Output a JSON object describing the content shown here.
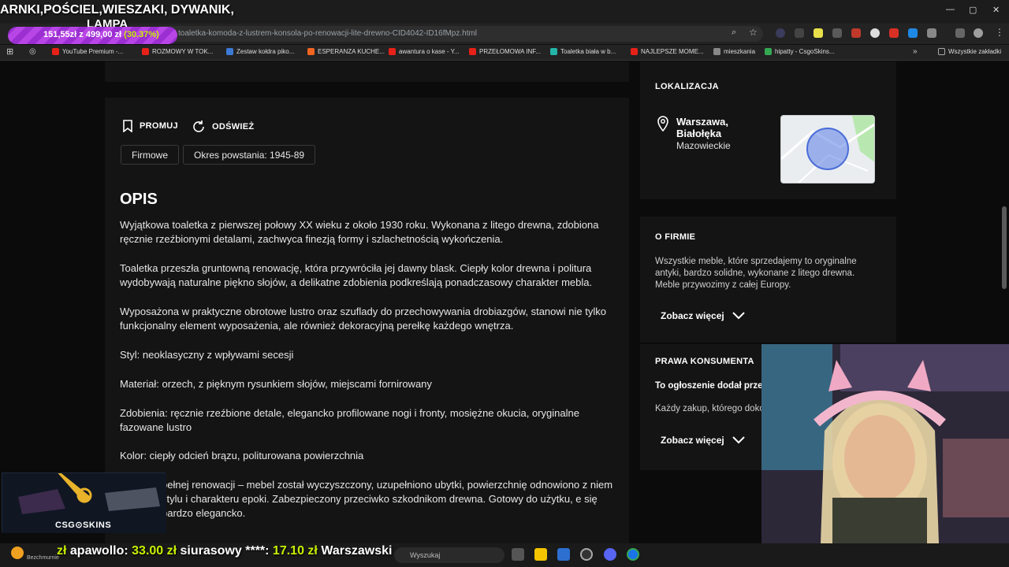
{
  "overlay": {
    "title_line1": "ARNKI,POŚCIEL,WIESZAKI, DYWANIK,",
    "title_line2": "LAMPA",
    "progress_current": "151,55zł",
    "progress_sep": "z",
    "progress_goal": "499,00 zł",
    "progress_percent_label": "(30.37%)",
    "progress_fraction": 0.3037
  },
  "browser": {
    "url": "toaletka-komoda-z-lustrem-konsola-po-renowacji-lite-drewno-CID4042-ID16fMpz.html",
    "bookmarks": [
      {
        "label": "YouTube Premium -...",
        "color": "#e62117"
      },
      {
        "label": "ROZMOWY W TOK...",
        "color": "#e62117"
      },
      {
        "label": "Zestaw kołdra piko...",
        "color": "#3d7ad6"
      },
      {
        "label": "ESPERANZA KUCHE...",
        "color": "#f26522"
      },
      {
        "label": "awantura o kase - Y...",
        "color": "#e62117"
      },
      {
        "label": "PRZEŁOMOWA INF...",
        "color": "#e62117"
      },
      {
        "label": "Toaletka biała w b...",
        "color": "#23b5a8"
      },
      {
        "label": "NAJLEPSZE MOME...",
        "color": "#e62117"
      },
      {
        "label": "mieszkania",
        "color": "#888888"
      },
      {
        "label": "hipatty - CsgoSkins...",
        "color": "#34a853"
      }
    ],
    "all_bookmarks": "Wszystkie zakładki"
  },
  "listing": {
    "promote": "PROMUJ",
    "refresh": "ODŚWIEŻ",
    "tags": [
      "Firmowe",
      "Okres powstania: 1945-89"
    ],
    "heading": "OPIS",
    "paragraphs": [
      "Wyjątkowa toaletka z pierwszej połowy XX wieku z około 1930 roku. Wykonana z litego drewna, zdobiona ręcznie rzeźbionymi detalami, zachwyca finezją formy i szlachetnością wykończenia.",
      "Toaletka przeszła gruntowną renowację, która przywróciła jej dawny blask. Ciepły kolor drewna i politura wydobywają naturalne piękno słojów, a delikatne zdobienia podkreślają ponadczasowy charakter mebla.",
      "Wyposażona w praktyczne obrotowe lustro oraz szuflady do przechowywania drobiazgów, stanowi nie tylko funkcjonalny element wyposażenia, ale również dekoracyjną perełkę każdego wnętrza.",
      "Styl: neoklasyczny z wpływami secesji",
      "Materiał: orzech, z pięknym rysunkiem słojów, miejscami fornirowany",
      "Zdobienia: ręcznie rzeźbione detale, elegancko profilowane nogi i fronty, mosiężne okucia, oryginalne fazowane lustro",
      "Kolor: ciepły odcień brązu, politurowana powierzchnia",
      "pełnej renowacji – mebel został wyczyszczony, uzupełniono ubytki, powierzchnię odnowiono z niem stylu i charakteru epoki. Zabezpieczony przeciwko szkodnikom drewna. Gotowy do użytku, e się bardzo elegancko."
    ]
  },
  "sidebar": {
    "location_title": "LOKALIZACJA",
    "city": "Warszawa, Białołęka",
    "region": "Mazowieckie",
    "company_title": "O FIRMIE",
    "company_text": "Wszystkie meble, które sprzedajemy to oryginalne antyki, bardzo solidne, wykonane z litego drewna. Meble przywozimy z całej Europy.",
    "see_more": "Zobacz więcej",
    "rights_title": "PRAWA KONSUMENTA",
    "rights_bold": "To ogłoszenie dodał prze",
    "rights_text": "Każdy zakup, którego doko"
  },
  "csg": {
    "label": "CSG⊙SKINS"
  },
  "ticker": {
    "items": [
      {
        "user": "apawollo:",
        "amount": "33.00 zł"
      },
      {
        "user": "siurasowy ****:",
        "amount": "17.10 zł"
      },
      {
        "user": "Warszawski",
        "amount": ""
      }
    ],
    "lead": "zł"
  },
  "taskbar": {
    "search_placeholder": "Wyszukaj",
    "status": "Bezchmurnie"
  }
}
